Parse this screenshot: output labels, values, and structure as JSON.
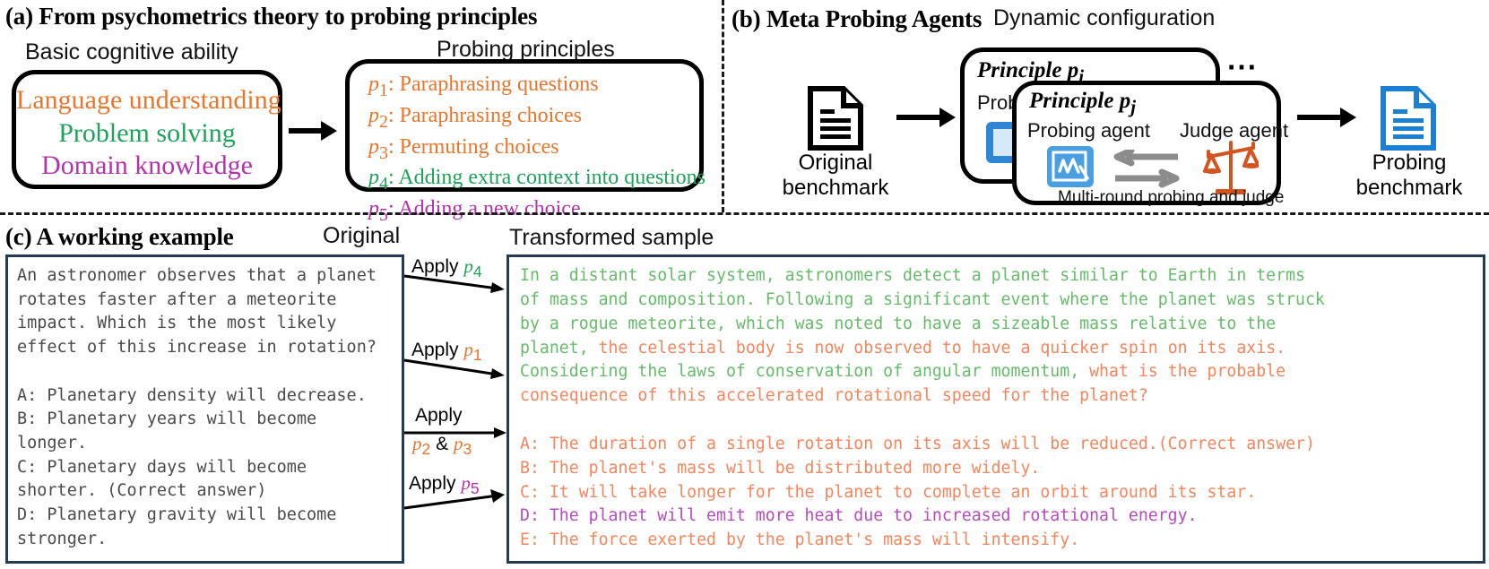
{
  "colors": {
    "orange": "#e8762c",
    "green": "#1fa25a",
    "magenta": "#b233ab",
    "mono_gray": "#4a4a4a",
    "trans_green": "#66bb6a",
    "trans_orange": "#f4855c",
    "trans_magenta": "#b44bbf",
    "box_navy": "#243b53",
    "icon_blue": "#2e86d4",
    "scale_orange": "#d4541f",
    "gray_arrow": "#8c8c8c"
  },
  "panel_a": {
    "title": "(a) From psychometrics theory to probing principles",
    "left_label": "Basic cognitive ability",
    "right_label": "Probing principles",
    "abilities": [
      {
        "text": "Language understanding",
        "color": "orange"
      },
      {
        "text": "Problem solving",
        "color": "green"
      },
      {
        "text": "Domain knowledge",
        "color": "magenta"
      }
    ],
    "principles": [
      {
        "id": "p",
        "sub": "1",
        "text": ": Paraphrasing questions",
        "color": "orange"
      },
      {
        "id": "p",
        "sub": "2",
        "text": ": Paraphrasing choices",
        "color": "orange"
      },
      {
        "id": "p",
        "sub": "3",
        "text": ": Permuting choices",
        "color": "orange"
      },
      {
        "id": "p",
        "sub": "4",
        "text": ": Adding extra context into questions",
        "color": "green"
      },
      {
        "id": "p",
        "sub": "5",
        "text": ": Adding a new choice",
        "color": "magenta"
      }
    ]
  },
  "panel_b": {
    "title": "(b) Meta Probing Agents",
    "dynamic_config_label": "Dynamic configuration",
    "input_doc_caption_line1": "Original",
    "input_doc_caption_line2": "benchmark",
    "output_doc_caption_line1": "Probing",
    "output_doc_caption_line2": "benchmark",
    "card_back": {
      "title_prefix": "Principle",
      "var": "p",
      "sub": "i",
      "partial_label": "Probin"
    },
    "card_front": {
      "title_prefix": "Principle",
      "var": "p",
      "sub": "j",
      "probing_agent_label": "Probing agent",
      "judge_agent_label": "Judge agent",
      "footer_label": "Multi-round  probing and judge"
    },
    "ellipsis": "⋯"
  },
  "panel_c": {
    "title": "(c) A working example",
    "original_label": "Original",
    "transformed_label": "Transformed sample",
    "original_text": "An astronomer observes that a planet\nrotates faster after a meteorite\nimpact. Which is the most likely\neffect of this increase in rotation?\n\nA: Planetary density will decrease.\nB: Planetary years will become\nlonger.\nC: Planetary days will become\nshorter. (Correct answer)\nD: Planetary gravity will become\nstronger.",
    "apply_arrows": [
      {
        "word": "Apply",
        "var": "p",
        "sub": "4",
        "color": "green"
      },
      {
        "word": "Apply",
        "var": "p",
        "sub": "1",
        "color": "orange"
      },
      {
        "word": "Apply",
        "var": "p",
        "sub": "2",
        "sub2": "3",
        "amp": "&",
        "color": "orange",
        "two_line": true
      },
      {
        "word": "Apply",
        "var": "p",
        "sub": "5",
        "color": "magenta"
      }
    ],
    "transformed_segments": [
      {
        "text": "In a distant solar system, astronomers detect a planet similar to Earth in terms\nof mass and composition. Following a significant event where the planet was struck\nby a rogue meteorite, which was noted to have a sizeable mass relative to the\nplanet, ",
        "color": "trans_green"
      },
      {
        "text": "the celestial body is now observed to have a quicker spin on its axis.\n",
        "color": "trans_orange"
      },
      {
        "text": "Considering the laws of conservation of angular momentum, ",
        "color": "trans_green"
      },
      {
        "text": "what is the probable\nconsequence of this accelerated rotational speed for the planet?\n\nA: The duration of a single rotation on its axis will be reduced.(Correct answer)\nB: The planet's mass will be distributed more widely.\nC: It will take longer for the planet to complete an orbit around its star.\n",
        "color": "trans_orange"
      },
      {
        "text": "D: The planet will emit more heat due to increased rotational energy.\n",
        "color": "trans_magenta"
      },
      {
        "text": "E: The force exerted by the planet's mass will intensify.",
        "color": "trans_orange"
      }
    ]
  }
}
